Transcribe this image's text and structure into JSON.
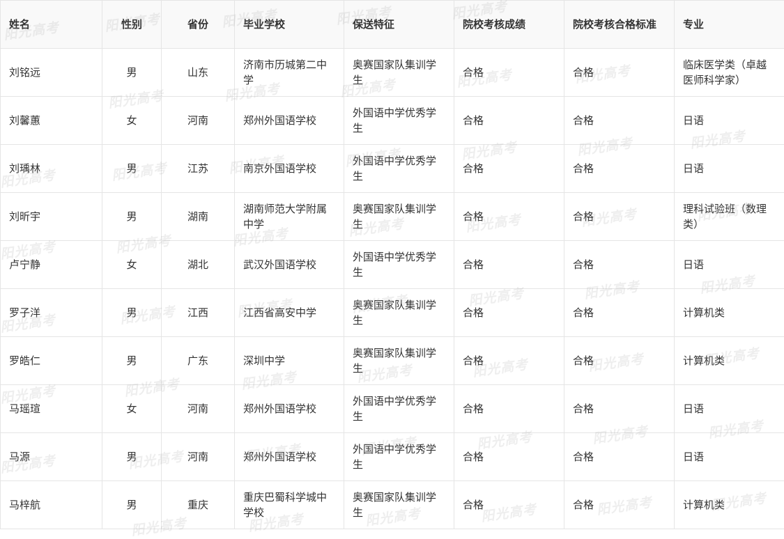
{
  "table": {
    "headers": [
      "姓名",
      "性别",
      "省份",
      "毕业学校",
      "保送特征",
      "院校考核成绩",
      "院校考核合格标准",
      "专业"
    ],
    "rows": [
      [
        "刘铭远",
        "男",
        "山东",
        "济南市历城第二中学",
        "奥赛国家队集训学生",
        "合格",
        "合格",
        "临床医学类（卓越医师科学家）"
      ],
      [
        "刘馨蕙",
        "女",
        "河南",
        "郑州外国语学校",
        "外国语中学优秀学生",
        "合格",
        "合格",
        "日语"
      ],
      [
        "刘瑀林",
        "男",
        "江苏",
        "南京外国语学校",
        "外国语中学优秀学生",
        "合格",
        "合格",
        "日语"
      ],
      [
        "刘昕宇",
        "男",
        "湖南",
        "湖南师范大学附属中学",
        "奥赛国家队集训学生",
        "合格",
        "合格",
        "理科试验班（数理类）"
      ],
      [
        "卢宁静",
        "女",
        "湖北",
        "武汉外国语学校",
        "外国语中学优秀学生",
        "合格",
        "合格",
        "日语"
      ],
      [
        "罗子洋",
        "男",
        "江西",
        "江西省高安中学",
        "奥赛国家队集训学生",
        "合格",
        "合格",
        "计算机类"
      ],
      [
        "罗皓仁",
        "男",
        "广东",
        "深圳中学",
        "奥赛国家队集训学生",
        "合格",
        "合格",
        "计算机类"
      ],
      [
        "马瑶瑄",
        "女",
        "河南",
        "郑州外国语学校",
        "外国语中学优秀学生",
        "合格",
        "合格",
        "日语"
      ],
      [
        "马源",
        "男",
        "河南",
        "郑州外国语学校",
        "外国语中学优秀学生",
        "合格",
        "合格",
        "日语"
      ],
      [
        "马梓航",
        "男",
        "重庆",
        "重庆巴蜀科学城中学校",
        "奥赛国家队集训学生",
        "合格",
        "合格",
        "计算机类"
      ]
    ]
  },
  "watermark": "阳光高考",
  "colors": {
    "border": "#e5e5e5",
    "text": "#333333",
    "header_bg": "#f9f9f9"
  }
}
